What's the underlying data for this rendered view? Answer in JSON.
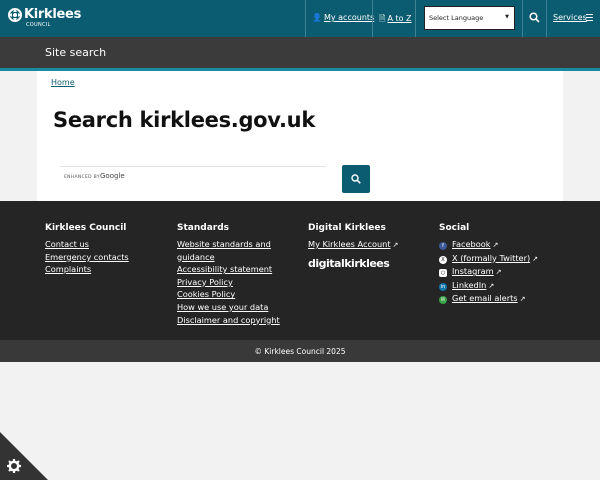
{
  "header": {
    "logo_text": "Kirklees",
    "logo_sub": "COUNCIL",
    "my_accounts": "My accounts",
    "a_to_z": "A to Z",
    "language_select": "Select Language",
    "services": "Services"
  },
  "subheader": {
    "title": "Site search"
  },
  "main": {
    "breadcrumb": "Home",
    "title": "Search kirklees.gov.uk",
    "search": {
      "enhanced_by": "ENHANCED BY",
      "google": "Google"
    }
  },
  "footer": {
    "columns": [
      {
        "heading": "Kirklees Council",
        "links": [
          "Contact us",
          "Emergency contacts",
          "Complaints"
        ]
      },
      {
        "heading": "Standards",
        "links": [
          "Website standards and",
          "guidance",
          "Accessibility statement",
          "Privacy Policy",
          "Cookies Policy",
          "How we use your data",
          "Disclaimer and copyright"
        ]
      },
      {
        "heading": "Digital Kirklees",
        "links": [
          "My Kirklees Account"
        ],
        "logo_text": "digitalkirklees"
      },
      {
        "heading": "Social",
        "links": [
          "Facebook",
          "X (formally Twitter)",
          "Instagram",
          "LinkedIn",
          "Get email alerts"
        ]
      }
    ],
    "copyright": "© Kirklees Council 2025"
  },
  "colors": {
    "header": "#0b5c70",
    "subheader": "#3b3b3b",
    "accent_line": "#1a8aa0",
    "footer": "#252525"
  }
}
